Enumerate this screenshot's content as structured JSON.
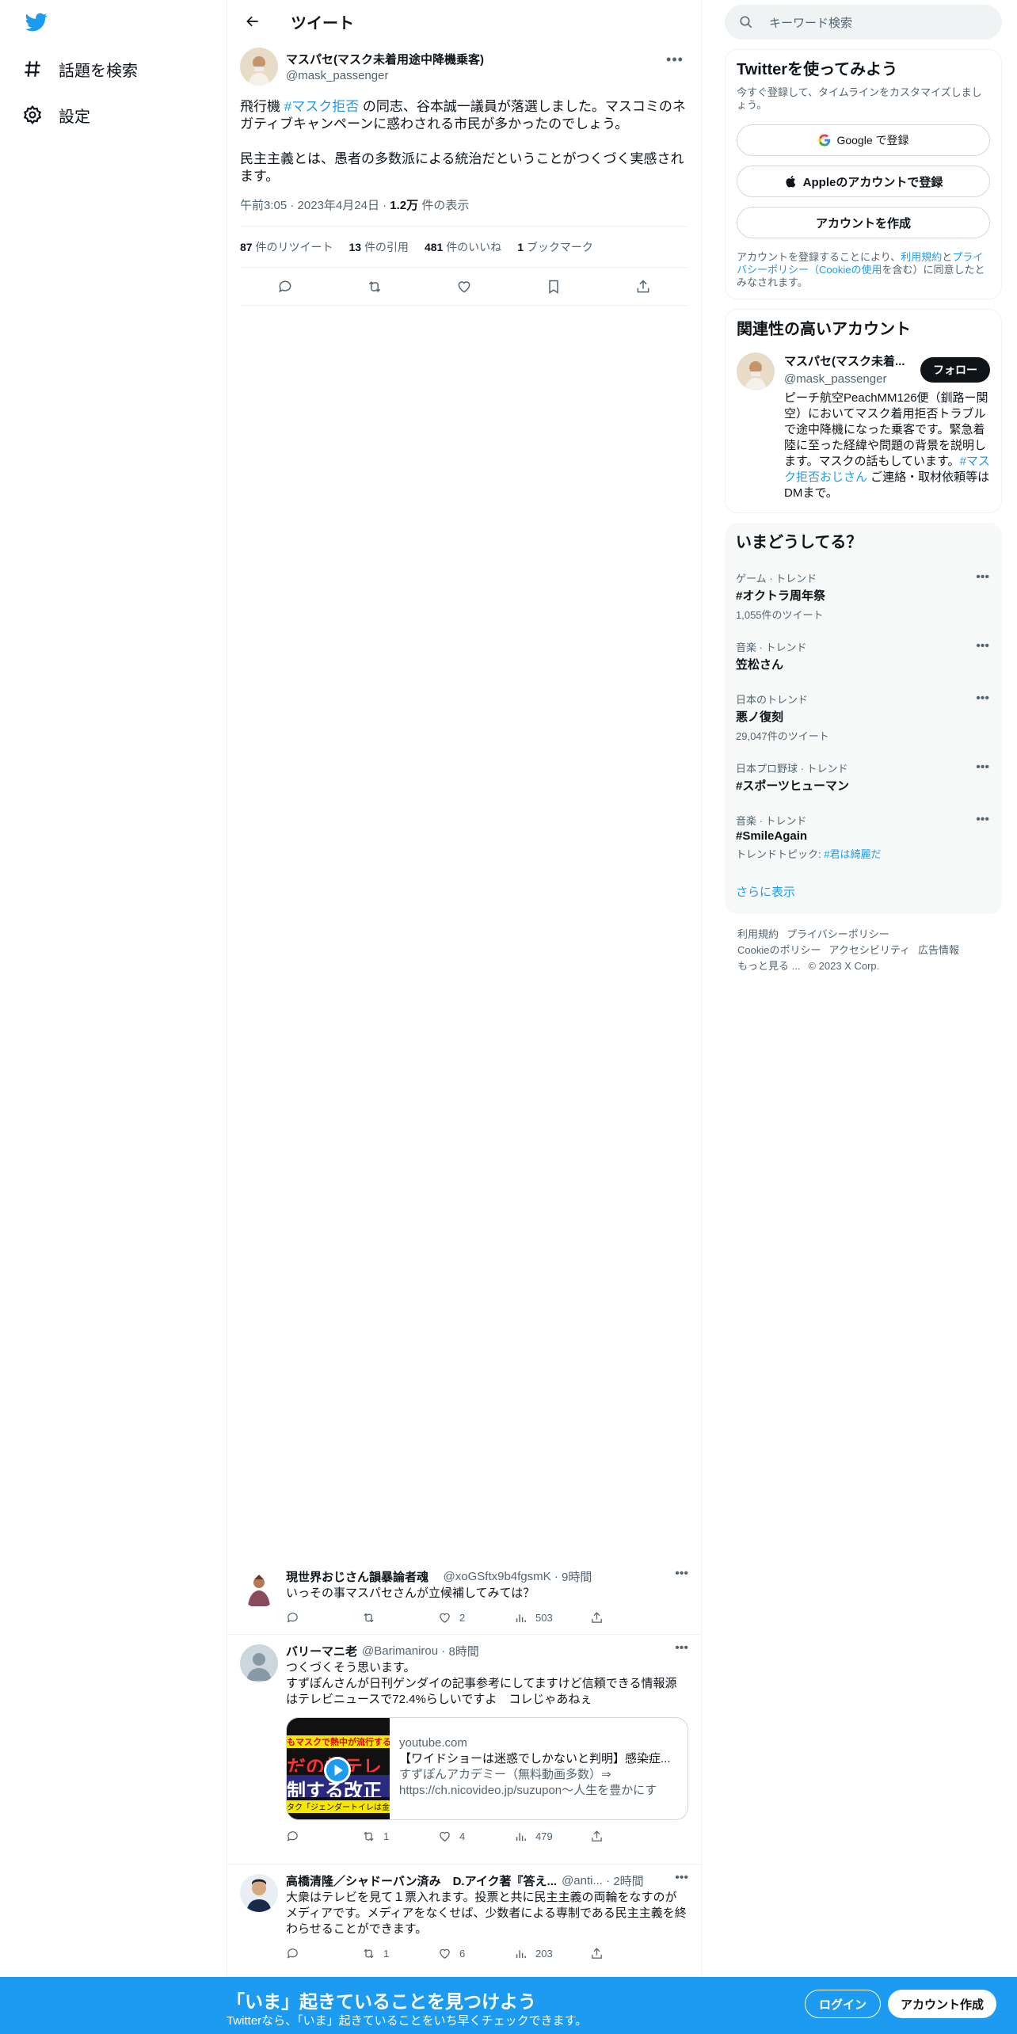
{
  "nav": {
    "explore_label": "話題を検索",
    "settings_label": "設定"
  },
  "header": {
    "title": "ツイート"
  },
  "tweet": {
    "author_name": "マスパセ(マスク未着用途中降機乗客)",
    "author_handle": "@mask_passenger",
    "text_pre": "飛行機 ",
    "hashtag": "#マスク拒否",
    "text_post": " の同志、谷本誠一議員が落選しました。マスコミのネガティブキャンペーンに惑わされる市民が多かったのでしょう。",
    "text_para2": "民主主義とは、愚者の多数派による統治だということがつくづく実感されます。",
    "time": "午前3:05",
    "date": "2023年4月24日",
    "views": "1.2万",
    "views_label": "件の表示",
    "retweets": "87",
    "retweets_label": "件のリツイート",
    "quotes": "13",
    "quotes_label": "件の引用",
    "likes": "481",
    "likes_label": "件のいいね",
    "bookmarks": "1",
    "bookmarks_label": "ブックマーク"
  },
  "replies": [
    {
      "name": "現世界おじさん韻暴論者魂",
      "handle": "@xoGSftx9b4fgsmK",
      "time": "9時間",
      "text": "いっその事マスパセさんが立候補してみては？",
      "reply_count": "",
      "retweet_count": "",
      "like_count": "2",
      "view_count": "503"
    },
    {
      "name": "バリーマニ老",
      "handle": "@Barimanirou",
      "time": "8時間",
      "text": "つくづくそう思います。\nすずぽんさんが日刊ゲンダイの記事参考にしてますけど信頼できる情報源はテレビニュースで72.4%らしいですよ　コレじゃあねぇ",
      "card_domain": "youtube.com",
      "card_title": "【ワイドショーは迷惑でしかないと判明】感染症...",
      "card_desc": "すずぽんアカデミー（無料動画多数）⇒ https://ch.nicovideo.jp/suzupon〜人生を豊かにする...",
      "card_thumb_text1": "もマスクで熱中が流行する",
      "card_thumb_text2": "だの為テレ",
      "card_thumb_text3": "制する改正",
      "card_thumb_text4": "タク「ジェンダートイレは金盗",
      "reply_count": "",
      "retweet_count": "1",
      "like_count": "4",
      "view_count": "479"
    },
    {
      "name": "高橋清隆／シャドーバン済み　D.アイク著『答え...",
      "handle": "@anti...",
      "time": "2時間",
      "text": "大衆はテレビを見て１票入れます。投票と共に民主主義の両輪をなすのがメディアです。メディアをなくせば、少数者による専制である民主主義を終わらせることができます。",
      "reply_count": "",
      "retweet_count": "1",
      "like_count": "6",
      "view_count": "203"
    }
  ],
  "search": {
    "placeholder": "キーワード検索"
  },
  "signup_panel": {
    "title": "Twitterを使ってみよう",
    "subtitle": "今すぐ登録して、タイムラインをカスタマイズしましょう。",
    "google_label": "Google で登録",
    "apple_label": "Appleのアカウントで登録",
    "create_label": "アカウントを作成",
    "legal_pre": "アカウントを登録することにより、",
    "legal_terms": "利用規約",
    "legal_and": "と",
    "legal_privacy": "プライバシーポリシー（Cookieの使用",
    "legal_post": "を含む）に同意したとみなされます。"
  },
  "related_panel": {
    "title": "関連性の高いアカウント",
    "name": "マスパセ(マスク未着...",
    "handle": "@mask_passenger",
    "follow_label": "フォロー",
    "bio_pre": "ピーチ航空PeachMM126便（釧路ー関空）においてマスク着用拒否トラブルで途中降機になった乗客です。緊急着陸に至った経緯や問題の背景を説明します。マスクの話もしています。",
    "bio_tag": "#マスク拒否おじさん",
    "bio_post": " ご連絡・取材依頼等はDMまで。"
  },
  "trends_panel": {
    "title": "いまどうしてる？",
    "items": [
      {
        "category": "ゲーム · トレンド",
        "name": "#オクトラ周年祭",
        "count": "1,055件のツイート"
      },
      {
        "category": "音楽 · トレンド",
        "name": "笠松さん",
        "count": ""
      },
      {
        "category": "日本のトレンド",
        "name": "悪ノ復刻",
        "count": "29,047件のツイート"
      },
      {
        "category": "日本プロ野球 · トレンド",
        "name": "#スポーツヒューマン",
        "count": ""
      },
      {
        "category": "音楽 · トレンド",
        "name": "#SmileAgain",
        "count": "トレンドトピック: ",
        "topic": "#君は綺麗だ"
      }
    ],
    "show_more": "さらに表示"
  },
  "footer": {
    "terms": "利用規約",
    "privacy": "プライバシーポリシー",
    "cookie": "Cookieのポリシー",
    "accessibility": "アクセシビリティ",
    "ads": "広告情報",
    "more": "もっと見る ...",
    "copyright": "© 2023 X Corp."
  },
  "bottom_bar": {
    "title": "「いま」起きていることを見つけよう",
    "subtitle": "Twitterなら、「いま」起きていることをいち早くチェックできます。",
    "login_label": "ログイン",
    "signup_label": "アカウント作成"
  },
  "colors": {
    "accent": "#1d9bf0",
    "text": "#0f1419",
    "muted": "#536471"
  }
}
